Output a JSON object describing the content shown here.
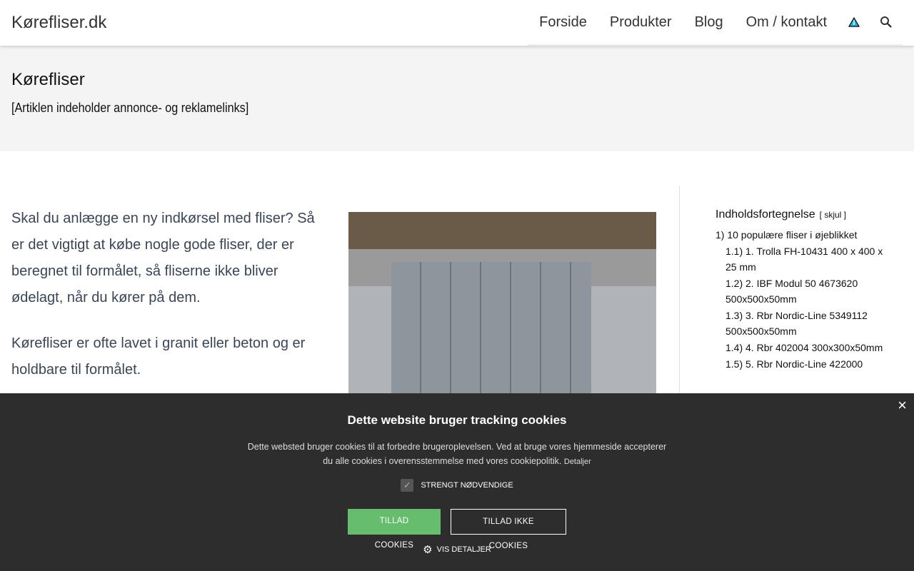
{
  "header": {
    "logo": "Kørefliser.dk",
    "nav": [
      "Forside",
      "Produkter",
      "Blog",
      "Om / kontakt"
    ]
  },
  "hero": {
    "title": "Kørefliser",
    "subtitle": "[Artiklen indeholder annonce- og reklamelinks]"
  },
  "intro": [
    "Skal du anlægge en ny indkørsel med fliser? Så er det vigtigt at købe nogle gode fliser, der er beregnet til formålet, så fliserne ikke bliver ødelagt, når du kører på dem.",
    "Kørefliser er ofte lavet i granit eller beton og er holdbare til formålet."
  ],
  "toc": {
    "title": "Indholdsfortegnelse",
    "toggle": "[ skjul ]",
    "items": [
      {
        "num": "1)",
        "label": "10 populære fliser i øjeblikket"
      },
      {
        "num": "1.1)",
        "label": "1. Trolla FH-10431 400 x 400 x 25 mm"
      },
      {
        "num": "1.2)",
        "label": "2. IBF Modul 50 4673620 500x500x50mm"
      },
      {
        "num": "1.3)",
        "label": "3. Rbr Nordic-Line 5349112 500x500x50mm"
      },
      {
        "num": "1.4)",
        "label": "4. Rbr 402004 300x300x50mm"
      },
      {
        "num": "1.5)",
        "label": "5. Rbr Nordic-Line 422000"
      }
    ]
  },
  "cookie": {
    "title": "Dette website bruger tracking cookies",
    "text": "Dette websted bruger cookies til at forbedre brugeroplevelsen. Ved at bruge vores hjemmeside accepterer du alle cookies i overensstemmelse med vores cookiepolitik.",
    "details_link": "Detaljer",
    "checkbox": "STRENGT NØDVENDIGE",
    "allow": "TILLAD COOKIES",
    "deny": "TILLAD IKKE COOKIES",
    "show_details": "VIS DETALJER",
    "close": "×"
  }
}
